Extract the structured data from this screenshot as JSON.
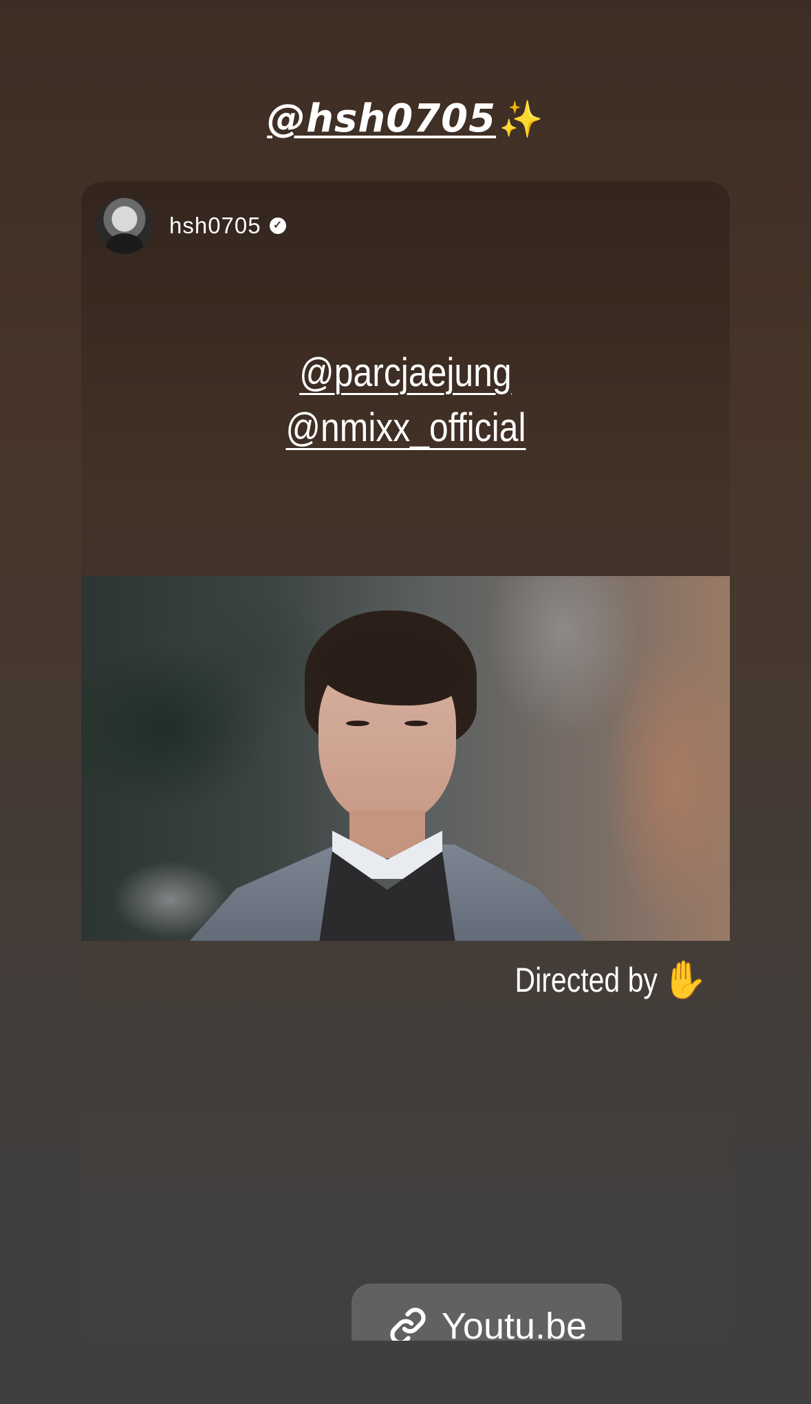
{
  "story": {
    "mention_handle": "@hsh0705",
    "mention_emoji": "✨"
  },
  "post": {
    "username": "hsh0705",
    "verified": true,
    "mentions": [
      "@parcjaejung",
      "@nmixx_official"
    ]
  },
  "caption": {
    "text": "Directed by",
    "emoji": "✋"
  },
  "link_sticker": {
    "label": "Youtu.be",
    "icon": "link-icon"
  },
  "colors": {
    "background_top": "#3d2d24",
    "background_bottom": "#3f3f3f",
    "sparkle": "#f4cf5a",
    "hand": "#f2b82e"
  }
}
